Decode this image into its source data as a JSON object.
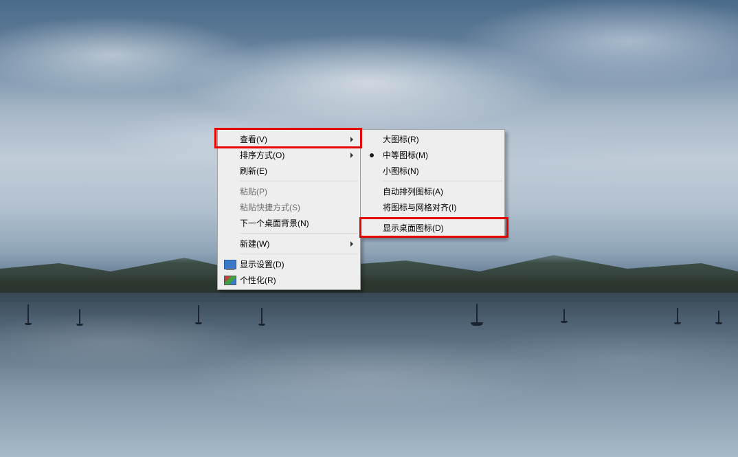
{
  "primaryMenu": {
    "view": "查看(V)",
    "sort": "排序方式(O)",
    "refresh": "刷新(E)",
    "paste": "粘贴(P)",
    "pasteShortcut": "粘贴快捷方式(S)",
    "nextBg": "下一个桌面背景(N)",
    "new": "新建(W)",
    "displaySettings": "显示设置(D)",
    "personalize": "个性化(R)"
  },
  "subMenu": {
    "largeIcons": "大图标(R)",
    "mediumIcons": "中等图标(M)",
    "smallIcons": "小图标(N)",
    "autoArrange": "自动排列图标(A)",
    "alignGrid": "将图标与网格对齐(I)",
    "showIcons": "显示桌面图标(D)"
  }
}
